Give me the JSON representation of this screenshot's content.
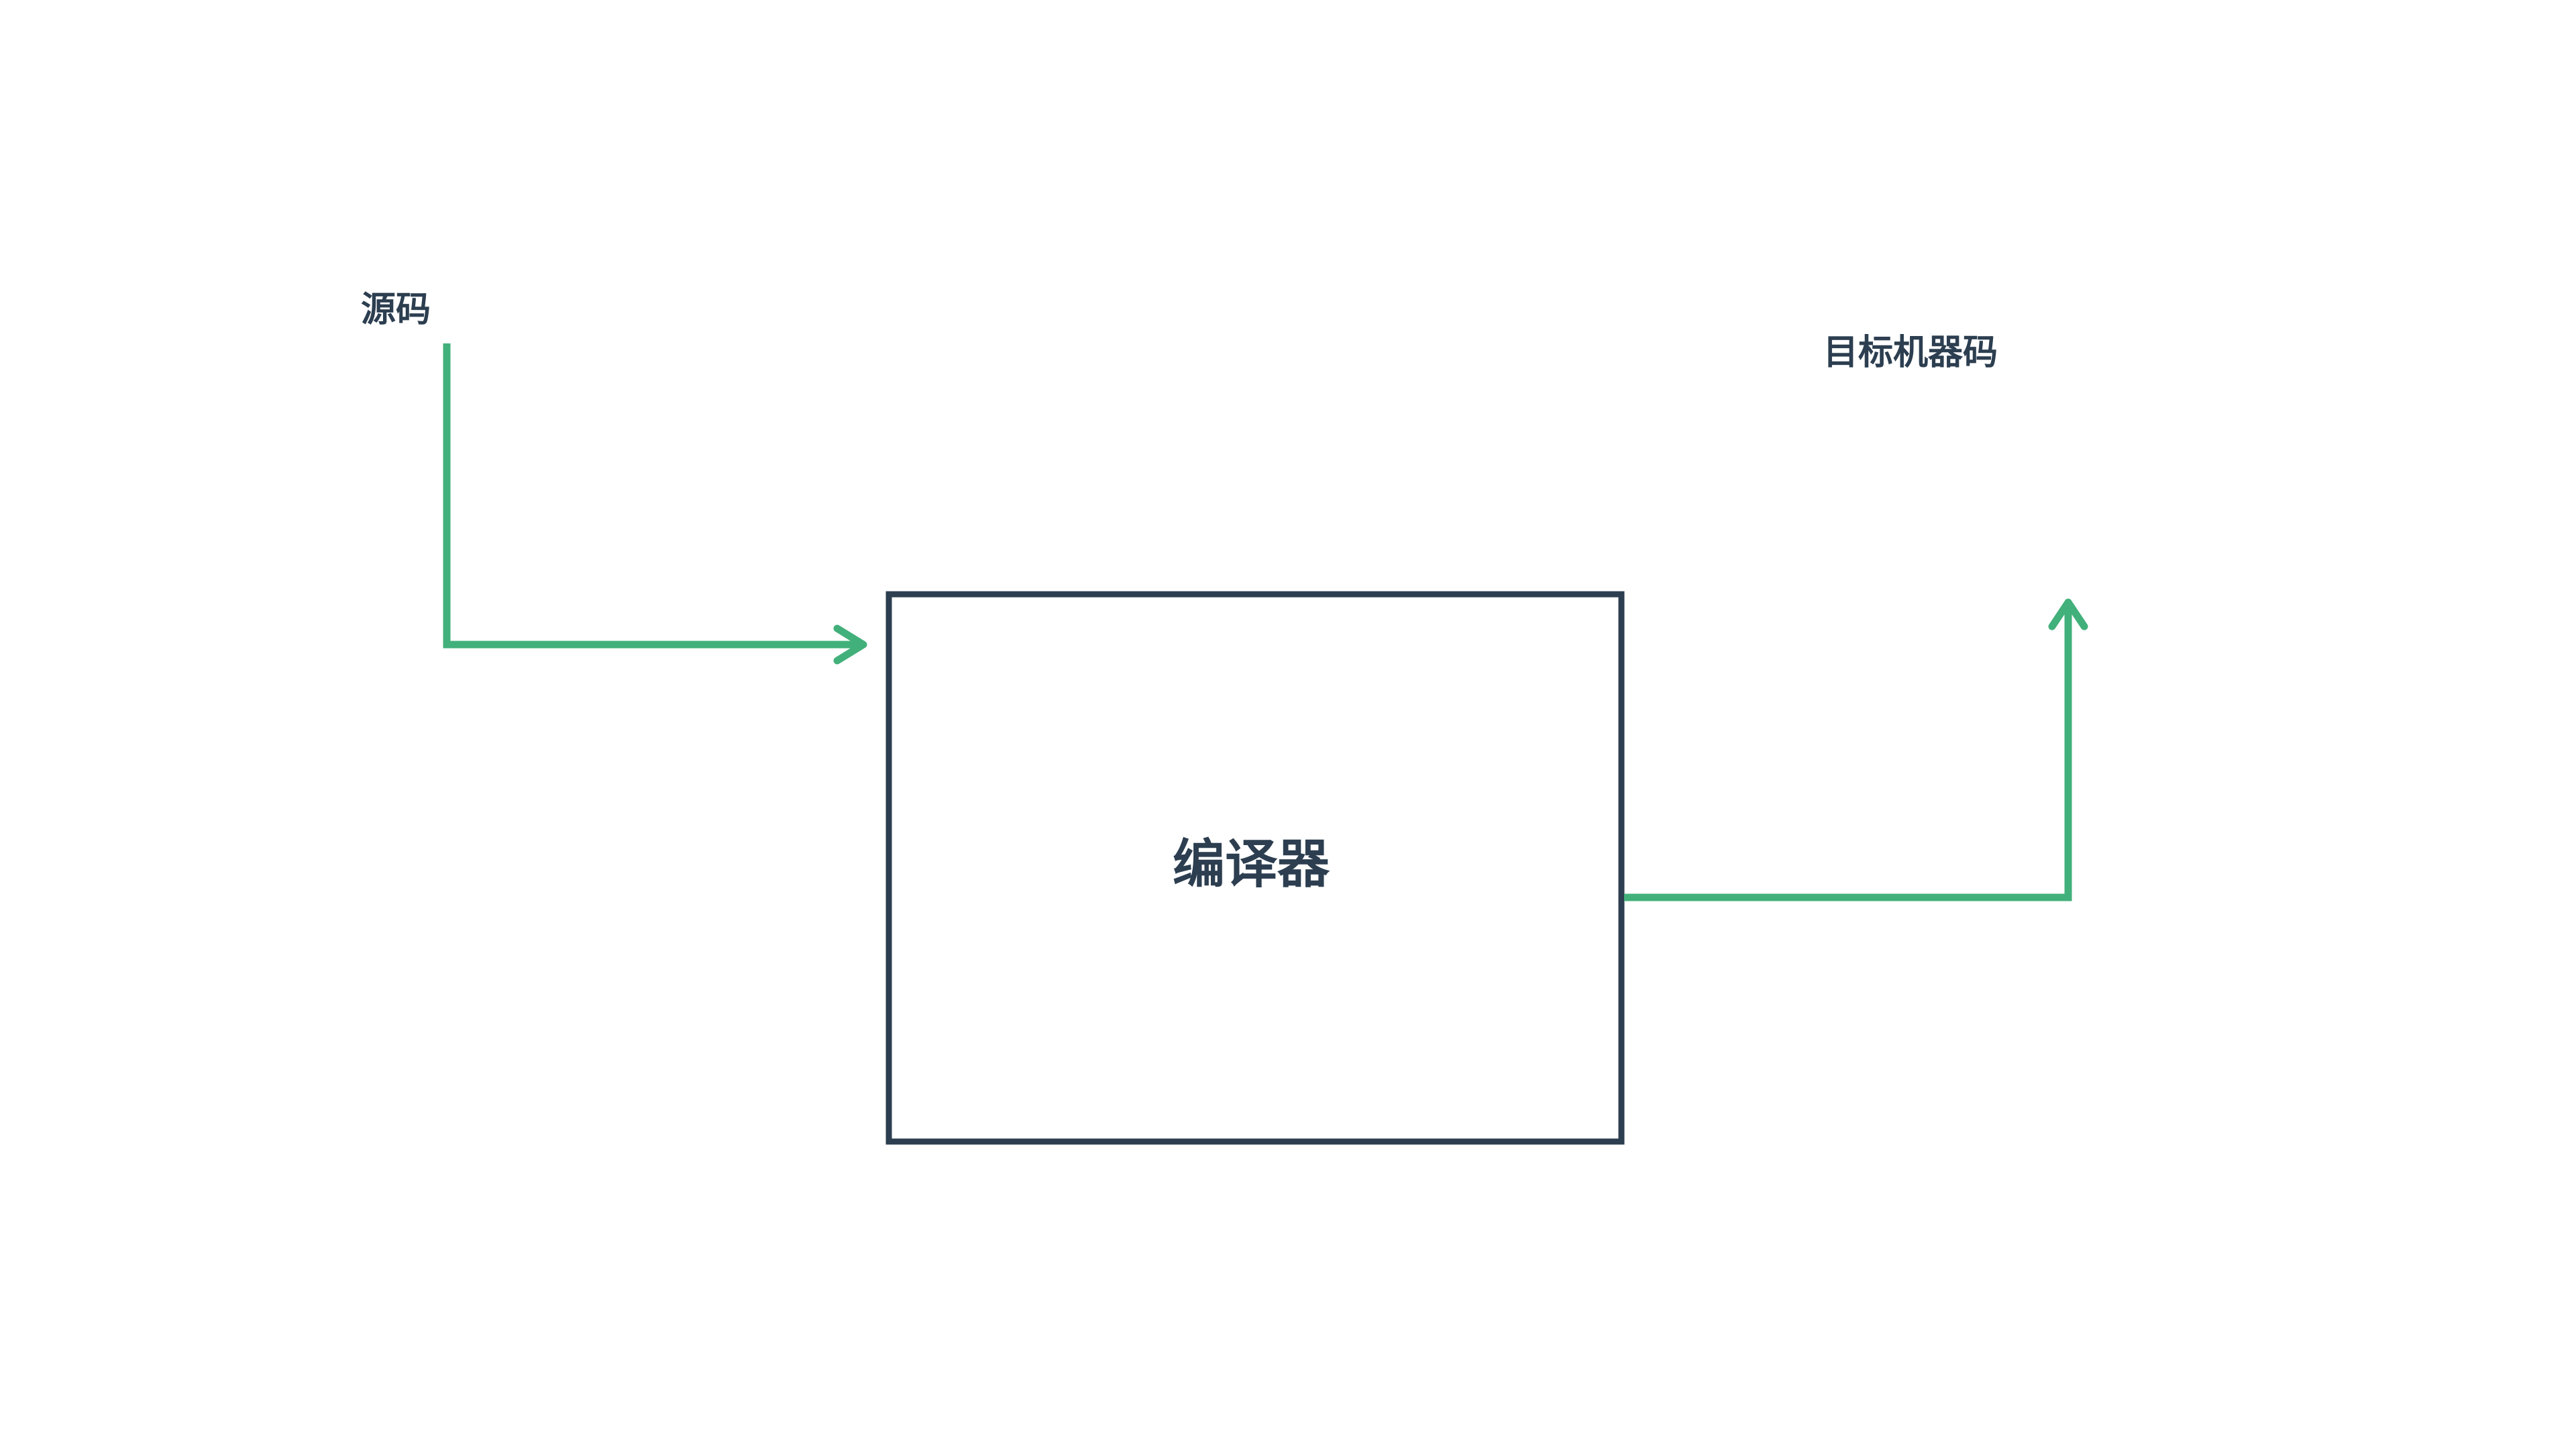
{
  "labels": {
    "source": "源码",
    "compiler": "编译器",
    "target": "目标机器码"
  },
  "colors": {
    "box_stroke": "#2c3e50",
    "arrow": "#42b07a",
    "text": "#2c3e50",
    "background": "#ffffff"
  }
}
